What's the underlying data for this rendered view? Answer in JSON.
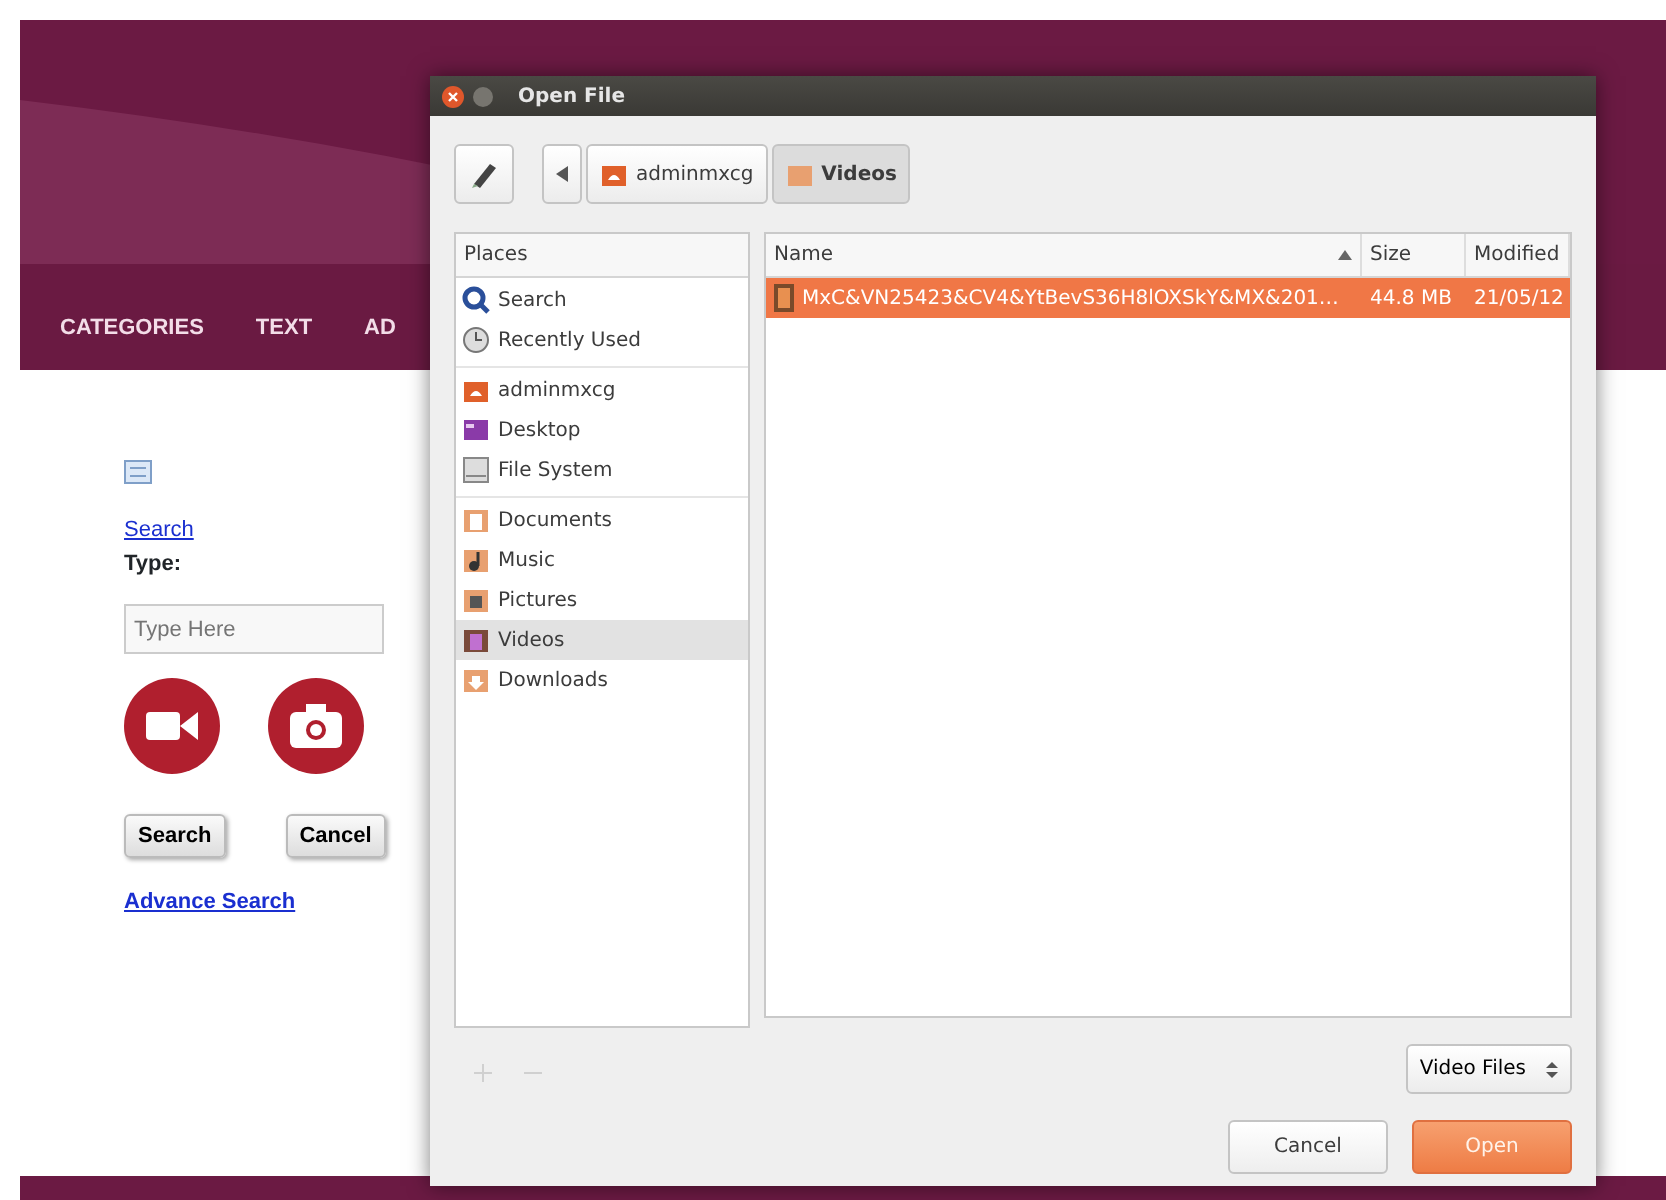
{
  "page": {
    "nav": [
      "CATEGORIES",
      "TEXT",
      "AD"
    ],
    "search_link": "Search",
    "type_label": "Type:",
    "type_field": {
      "placeholder": "Type Here"
    },
    "buttons": [
      "Search",
      "Cancel"
    ],
    "advance_link": "Advance Search"
  },
  "dialog": {
    "title": "Open File",
    "path": [
      {
        "label": "adminmxcg",
        "kind": "home",
        "selected": false
      },
      {
        "label": "Videos",
        "kind": "folder",
        "selected": true
      }
    ],
    "places": {
      "heading": "Places",
      "groups": [
        [
          {
            "label": "Search",
            "kind": "search",
            "selected": false
          },
          {
            "label": "Recently Used",
            "kind": "recent",
            "selected": false
          }
        ],
        [
          {
            "label": "adminmxcg",
            "kind": "home",
            "selected": false
          },
          {
            "label": "Desktop",
            "kind": "desktop",
            "selected": false
          },
          {
            "label": "File System",
            "kind": "drive",
            "selected": false
          }
        ],
        [
          {
            "label": "Documents",
            "kind": "documents",
            "selected": false
          },
          {
            "label": "Music",
            "kind": "music",
            "selected": false
          },
          {
            "label": "Pictures",
            "kind": "pictures",
            "selected": false
          },
          {
            "label": "Videos",
            "kind": "videos",
            "selected": true
          },
          {
            "label": "Downloads",
            "kind": "downloads",
            "selected": false
          }
        ]
      ]
    },
    "files": {
      "columns": [
        "Name",
        "Size",
        "Modified"
      ],
      "rows": [
        {
          "name": "MxC&VN25423&CV4&YtBevS36H8lOXSkY&MX&201…",
          "size": "44.8 MB",
          "modified": "21/05/12",
          "selected": true
        }
      ]
    },
    "filter": "Video Files",
    "buttons": [
      "Cancel",
      "Open"
    ]
  }
}
